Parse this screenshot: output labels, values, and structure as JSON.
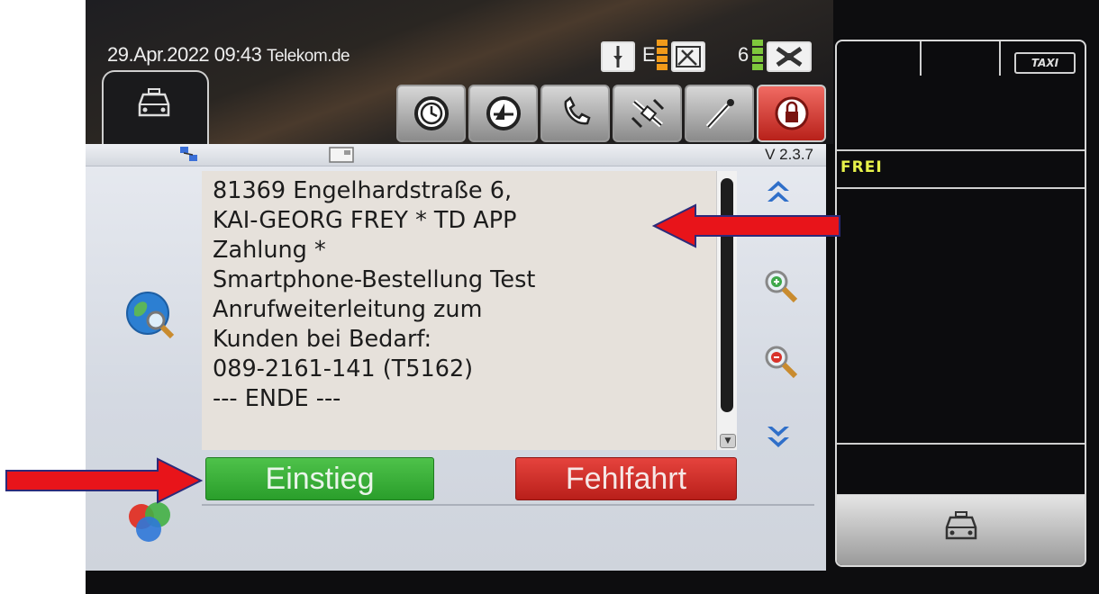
{
  "status": {
    "datetime": "29.Apr.2022 09:43",
    "network": "Telekom.de",
    "gps_label": "E",
    "signal_label": "6"
  },
  "toolbar": {
    "buttons": [
      "timer-icon",
      "phone-book-icon",
      "phone-icon",
      "satellite-icon",
      "settings-tool-icon",
      "lock-icon"
    ]
  },
  "panel": {
    "version": "V 2.3.7",
    "message_lines": [
      "81369 Engelhardstraße 6,",
      "KAI-GEORG FREY * TD APP",
      "Zahlung *",
      "Smartphone-Bestellung Test",
      "Anrufweiterleitung zum",
      "Kunden bei Bedarf:",
      "089-2161-141 (T5162)",
      "--- ENDE ---"
    ],
    "btn_einstieg": "Einstieg",
    "btn_fehlfahrt": "Fehlfahrt"
  },
  "right_panel": {
    "status": "FREI",
    "taxi_sign": "TAXI"
  },
  "colors": {
    "accent_green": "#2a9e2b",
    "accent_red": "#b91f1a",
    "status_yellow": "#e7f24a",
    "annotation_arrow": "#e8141a"
  }
}
